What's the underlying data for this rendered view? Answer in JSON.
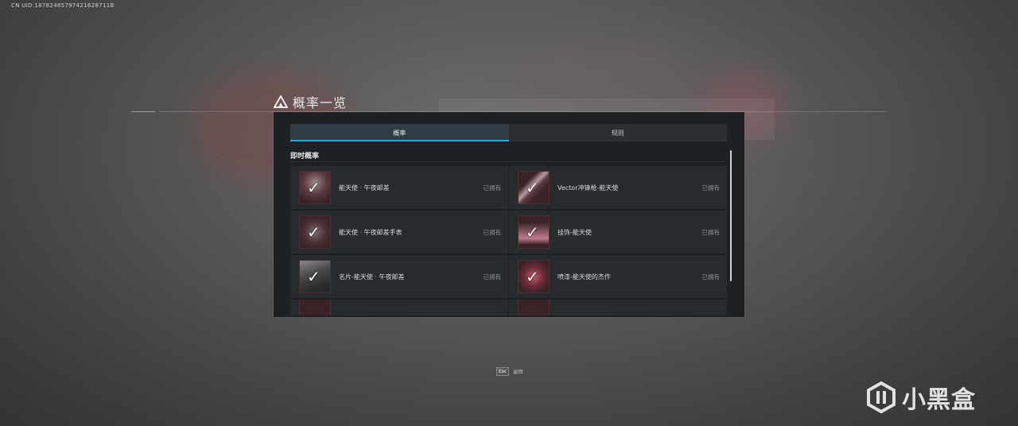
{
  "uid_text": "CN UID:18782485797421628711B",
  "title": "概率一览",
  "tabs": [
    {
      "label": "概率",
      "active": true
    },
    {
      "label": "规则",
      "active": false
    }
  ],
  "section": {
    "label": "即时概率"
  },
  "items": [
    {
      "name": "能天使 · 午夜邮差",
      "status": "已拥有",
      "icon": "character-skin-icon"
    },
    {
      "name": "Vector冲锋枪-能天使",
      "status": "已拥有",
      "icon": "weapon-icon"
    },
    {
      "name": "能天使 · 午夜邮差手表",
      "status": "已拥有",
      "icon": "watch-icon"
    },
    {
      "name": "挂饰-能天使",
      "status": "已拥有",
      "icon": "charm-icon"
    },
    {
      "name": "名片-能天使 · 午夜邮差",
      "status": "已拥有",
      "icon": "name-card-icon"
    },
    {
      "name": "喷漆-能天使的杰作",
      "status": "已拥有",
      "icon": "spray-icon"
    }
  ],
  "footer": {
    "key": "Esc",
    "label": "返回"
  },
  "watermark": {
    "text": "小黑盒"
  },
  "colors": {
    "accent": "#2fa7cf",
    "panel": "#1d2123",
    "item": "#272b2d"
  }
}
